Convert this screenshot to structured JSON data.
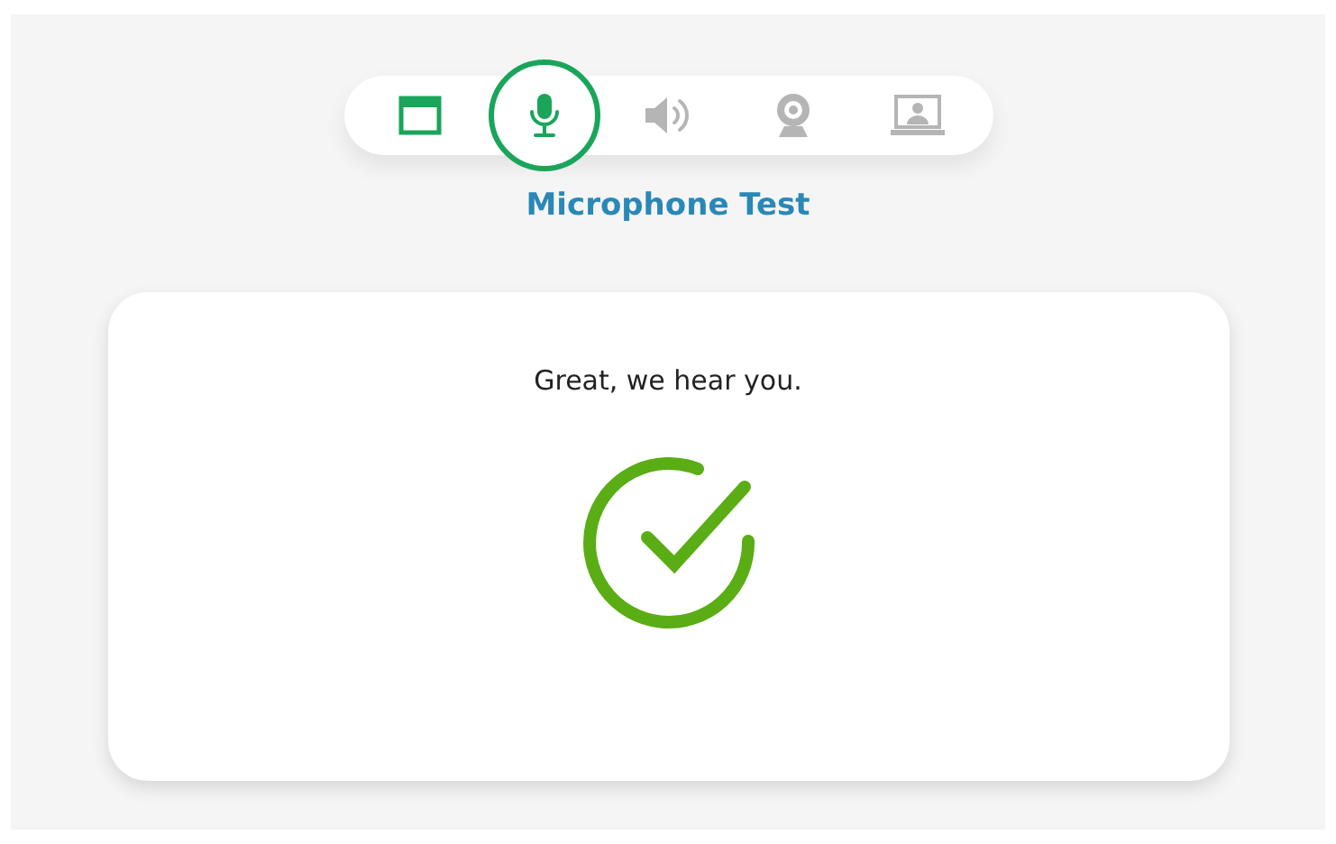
{
  "steps": [
    {
      "kind": "browser",
      "completed": true,
      "selected": false
    },
    {
      "kind": "microphone",
      "completed": false,
      "selected": true
    },
    {
      "kind": "speaker",
      "completed": false,
      "selected": false
    },
    {
      "kind": "webcam",
      "completed": false,
      "selected": false
    },
    {
      "kind": "screen",
      "completed": false,
      "selected": false
    }
  ],
  "title": "Microphone Test",
  "card": {
    "message": "Great, we hear you.",
    "kind": "success"
  }
}
